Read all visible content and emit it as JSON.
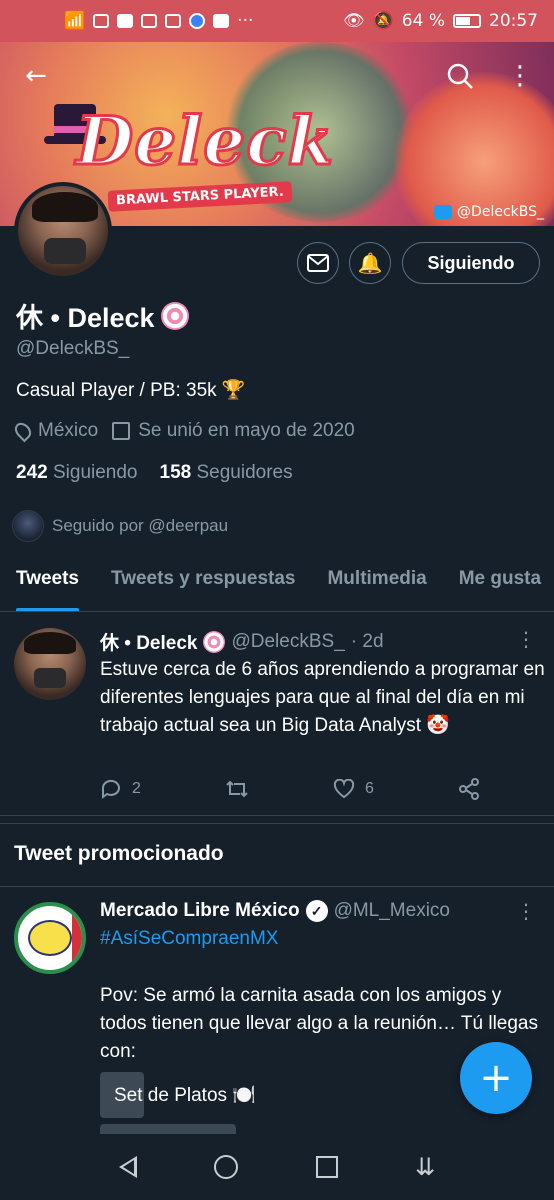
{
  "status_bar": {
    "left_icons": [
      "signal-icon",
      "wifi-icon",
      "app-icon",
      "discord-icon",
      "app-icon",
      "app-icon",
      "facebook-icon"
    ],
    "more": "···",
    "battery": "64 %",
    "battery_level": 0.64,
    "time": "20:57"
  },
  "banner": {
    "title": "Deleck",
    "subtitle": "BRAWL STARS PLAYER.",
    "tag": "@DeleckBS_"
  },
  "profile": {
    "name": "休 • Deleck",
    "handle": "@DeleckBS_",
    "bio": "Casual Player / PB: 35k 🏆",
    "location": "México",
    "joined": "Se unió en mayo de 2020",
    "following_count": "242",
    "following_label": "Siguiendo",
    "followers_count": "158",
    "followers_label": "Seguidores",
    "followed_by": "Seguido por @deerpau",
    "follow_button": "Siguiendo"
  },
  "tabs": [
    "Tweets",
    "Tweets y respuestas",
    "Multimedia",
    "Me gusta"
  ],
  "tweet": {
    "name": "休 • Deleck",
    "handle": "@DeleckBS_",
    "time": "· 2d",
    "text": "Estuve cerca de 6 años aprendiendo a programar en diferentes lenguajes para que al final del día en mi trabajo actual sea un Big Data Analyst 🤡",
    "replies": "2",
    "likes": "6"
  },
  "promoted": {
    "section_title": "Tweet promocionado",
    "name": "Mercado Libre México",
    "handle": "@ML_Mexico",
    "hashtag": "#AsíSeCompraenMX",
    "text": "Pov: Se armó la carnita asada con los amigos y todos tienen que llevar algo a la reunión… Tú llegas con:",
    "option1": "Set de Platos 🍽️"
  },
  "colors": {
    "background": "#15202b",
    "accent": "#1d9bf0",
    "muted": "#8899a6",
    "status_bar": "#d2535c"
  }
}
